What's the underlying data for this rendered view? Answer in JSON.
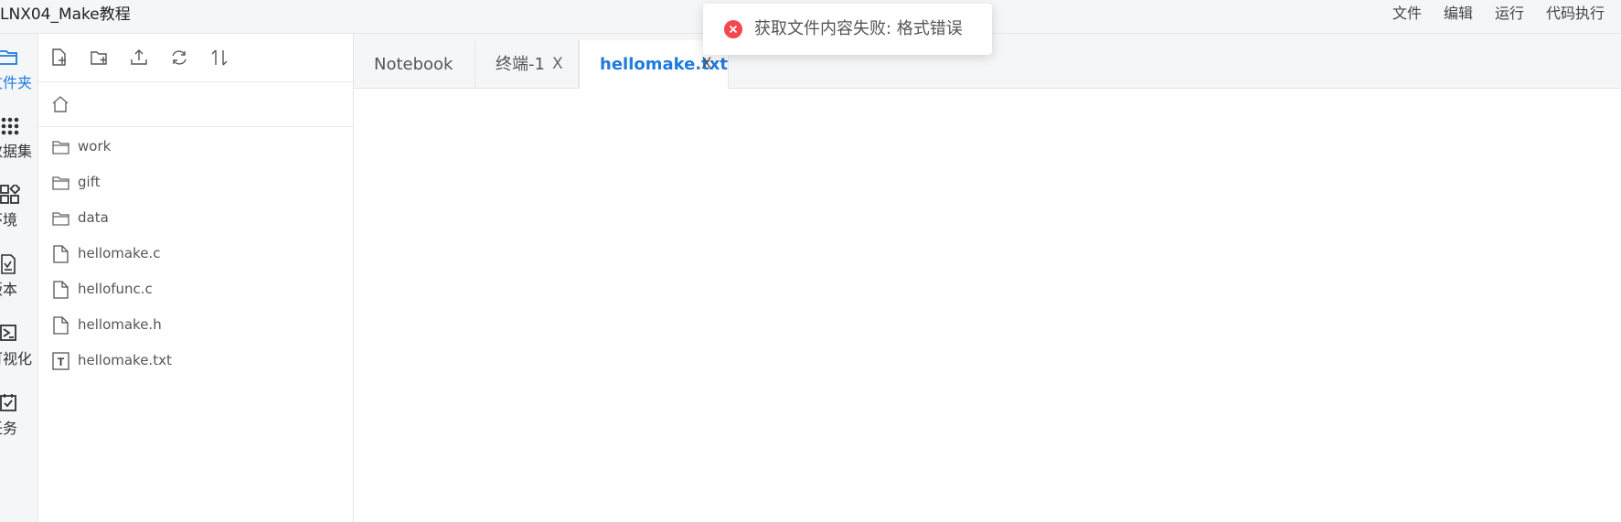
{
  "app": {
    "title": "LNX04_Make教程"
  },
  "menu": {
    "items": [
      {
        "label": "文件"
      },
      {
        "label": "编辑"
      },
      {
        "label": "运行"
      },
      {
        "label": "代码执行"
      }
    ]
  },
  "rail": {
    "items": [
      {
        "label": "文件夹",
        "icon": "folder-icon",
        "active": true
      },
      {
        "label": "数据集",
        "icon": "dataset-icon"
      },
      {
        "label": "环境",
        "icon": "environment-icon"
      },
      {
        "label": "版本",
        "icon": "version-icon"
      },
      {
        "label": "可视化",
        "icon": "visualization-icon"
      },
      {
        "label": "任务",
        "icon": "task-icon"
      }
    ]
  },
  "toolbar": {
    "buttons": [
      {
        "icon": "new-file-icon"
      },
      {
        "icon": "new-folder-icon"
      },
      {
        "icon": "upload-icon"
      },
      {
        "icon": "refresh-icon"
      },
      {
        "icon": "sort-icon"
      }
    ]
  },
  "path": {
    "icon": "home-icon"
  },
  "files": [
    {
      "name": "work",
      "type": "folder"
    },
    {
      "name": "gift",
      "type": "folder"
    },
    {
      "name": "data",
      "type": "folder"
    },
    {
      "name": "hellomake.c",
      "type": "file"
    },
    {
      "name": "hellofunc.c",
      "type": "file"
    },
    {
      "name": "hellomake.h",
      "type": "file"
    },
    {
      "name": "hellomake.txt",
      "type": "text-file",
      "glyph": "T"
    }
  ],
  "tabs": [
    {
      "label": "Notebook",
      "closable": false
    },
    {
      "label": "终端-1",
      "closable": true,
      "close": "X"
    },
    {
      "label": "hellomake.txt",
      "closable": true,
      "close": "X",
      "active": true
    }
  ],
  "toast": {
    "type": "error",
    "message": "获取文件内容失败: 格式错误",
    "color": "#f5474d"
  },
  "colors": {
    "accent": "#1f7ae0",
    "icon_stroke": "#555555"
  }
}
